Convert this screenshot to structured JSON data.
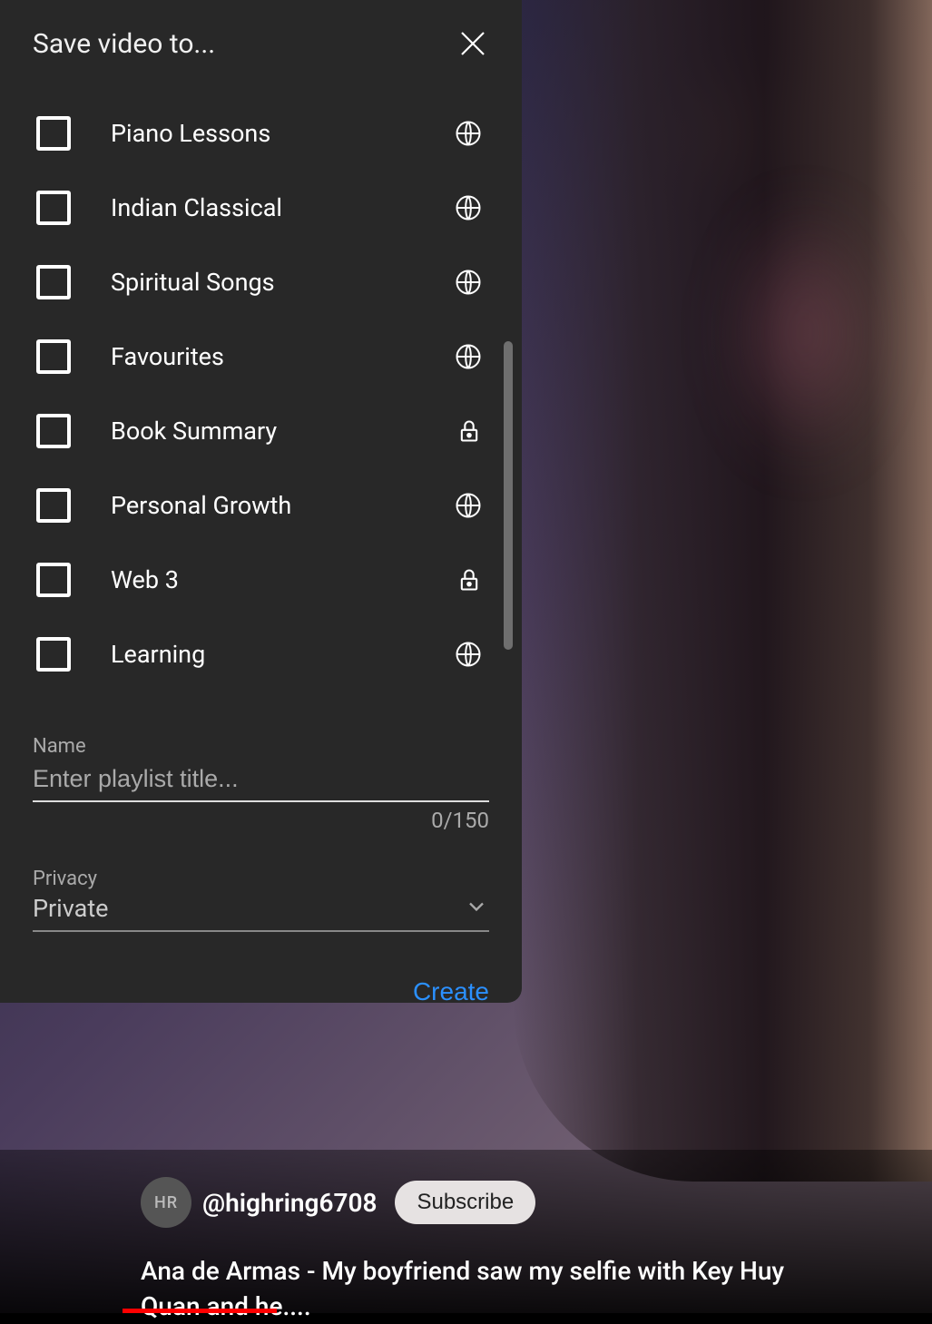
{
  "dialog": {
    "title": "Save video to...",
    "playlists": [
      {
        "name": "Piano Lessons",
        "privacy": "public"
      },
      {
        "name": "Indian Classical",
        "privacy": "public"
      },
      {
        "name": "Spiritual Songs",
        "privacy": "public"
      },
      {
        "name": "Favourites",
        "privacy": "public"
      },
      {
        "name": "Book Summary",
        "privacy": "private"
      },
      {
        "name": "Personal Growth",
        "privacy": "public"
      },
      {
        "name": "Web 3",
        "privacy": "private"
      },
      {
        "name": "Learning",
        "privacy": "public"
      }
    ],
    "form": {
      "name_label": "Name",
      "name_placeholder": "Enter playlist title...",
      "char_count": "0/150",
      "privacy_label": "Privacy",
      "privacy_value": "Private",
      "create_label": "Create"
    }
  },
  "video": {
    "channel_handle": "@highring6708",
    "channel_avatar_text": "HR",
    "subscribe_label": "Subscribe",
    "title": "Ana de Armas - My boyfriend saw my selfie with Key Huy Quan and he...."
  },
  "colors": {
    "dialog_bg": "#282828",
    "accent": "#2b90ff",
    "progress": "#ff0000"
  }
}
